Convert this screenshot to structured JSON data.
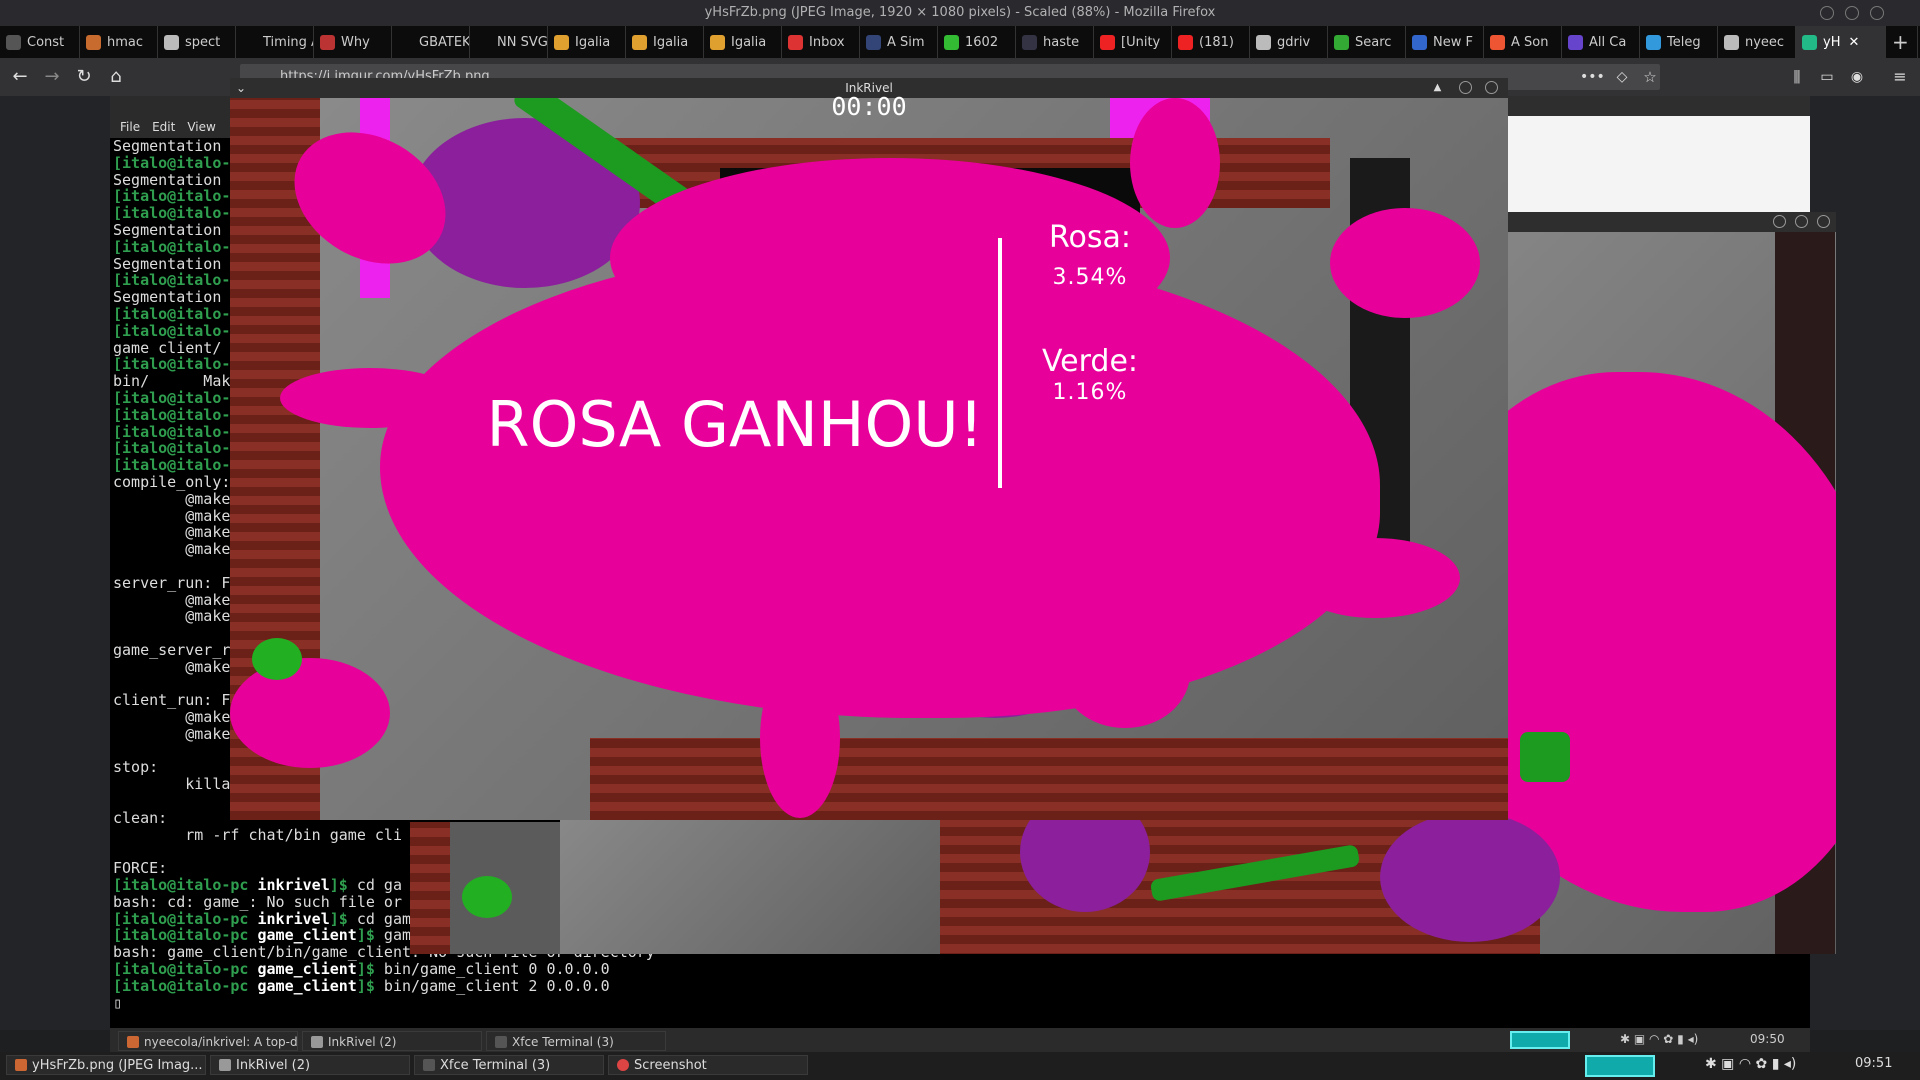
{
  "firefox": {
    "window_title": "yHsFrZb.png (JPEG Image, 1920 × 1080 pixels) - Scaled (88%) - Mozilla Firefox",
    "url": "https://i.imgur.com/yHsFrZb.png",
    "tabs": [
      {
        "label": "Const",
        "color": "#555"
      },
      {
        "label": "hmac",
        "color": "#c86b2f"
      },
      {
        "label": "spect",
        "color": "#bbb"
      },
      {
        "label": "Timing A",
        "color": "#0c0c0d"
      },
      {
        "label": "Why",
        "color": "#b33"
      },
      {
        "label": "GBATEK",
        "color": "#0c0c0d"
      },
      {
        "label": "NN SVG",
        "color": "#0c0c0d"
      },
      {
        "label": "Igalia",
        "color": "#e0a030"
      },
      {
        "label": "Igalia",
        "color": "#e0a030"
      },
      {
        "label": "Igalia",
        "color": "#e0a030"
      },
      {
        "label": "Inbox",
        "color": "#d33"
      },
      {
        "label": "A Sim",
        "color": "#347"
      },
      {
        "label": "1602",
        "color": "#3b3"
      },
      {
        "label": "haste",
        "color": "#334"
      },
      {
        "label": "[Unity",
        "color": "#e22"
      },
      {
        "label": "(181)",
        "color": "#e22"
      },
      {
        "label": "gdriv",
        "color": "#bbb"
      },
      {
        "label": "Searc",
        "color": "#3a3"
      },
      {
        "label": "New F",
        "color": "#36c"
      },
      {
        "label": "A Son",
        "color": "#e53"
      },
      {
        "label": "All Ca",
        "color": "#64c"
      },
      {
        "label": "Teleg",
        "color": "#39d"
      },
      {
        "label": "nyeec",
        "color": "#bbb"
      },
      {
        "label": "yH",
        "color": "#2b8"
      }
    ],
    "new_tab": "+",
    "close_tab": "✕"
  },
  "terminal": {
    "menu": [
      "File",
      "Edit",
      "View"
    ],
    "lines": [
      {
        "t": "Segmentation"
      },
      {
        "p": "[italo@italo-"
      },
      {
        "t": "Segmentation"
      },
      {
        "p": "[italo@italo-"
      },
      {
        "p": "[italo@italo-"
      },
      {
        "t": "Segmentation"
      },
      {
        "p": "[italo@italo-"
      },
      {
        "t": "Segmentation"
      },
      {
        "p": "[italo@italo-"
      },
      {
        "t": "Segmentation"
      },
      {
        "p": "[italo@italo-"
      },
      {
        "p": "[italo@italo-"
      },
      {
        "t": "game_client/"
      },
      {
        "p": "[italo@italo-"
      },
      {
        "t": "bin/      Mak"
      },
      {
        "p": "[italo@italo-"
      },
      {
        "p": "[italo@italo-"
      },
      {
        "p": "[italo@italo-"
      },
      {
        "p": "[italo@italo-"
      },
      {
        "p": "[italo@italo-"
      },
      {
        "t": "compile_only:"
      },
      {
        "t": "        @make"
      },
      {
        "t": "        @make"
      },
      {
        "t": "        @make"
      },
      {
        "t": "        @make"
      },
      {
        "t": ""
      },
      {
        "t": "server_run: F"
      },
      {
        "t": "        @make"
      },
      {
        "t": "        @make"
      },
      {
        "t": ""
      },
      {
        "t": "game_server_r"
      },
      {
        "t": "        @make"
      },
      {
        "t": ""
      },
      {
        "t": "client_run: F"
      },
      {
        "t": "        @make"
      },
      {
        "t": "        @make"
      },
      {
        "t": ""
      },
      {
        "t": "stop:"
      },
      {
        "t": "        killa"
      },
      {
        "t": ""
      },
      {
        "t": "clean:"
      },
      {
        "t": "        rm -rf chat/bin game_cli"
      },
      {
        "t": ""
      },
      {
        "t": "FORCE:"
      },
      {
        "p": "[italo@italo-pc ",
        "d": "inkrivel",
        "c": "]$ cd ga"
      },
      {
        "t": "bash: cd: game_: No such file or"
      },
      {
        "p": "[italo@italo-pc ",
        "d": "inkrivel",
        "c": "]$ cd game_client/"
      },
      {
        "p": "[italo@italo-pc ",
        "d": "game_client",
        "c": "]$ game_client/bin/game"
      },
      {
        "t": "bash: game_client/bin/game_client: No such file or directory"
      },
      {
        "p": "[italo@italo-pc ",
        "d": "game_client",
        "c": "]$ bin/game_client 0 0.0.0.0"
      },
      {
        "p": "[italo@italo-pc ",
        "d": "game_client",
        "c": "]$ bin/game_client 2 0.0.0.0"
      },
      {
        "t": "▯"
      }
    ]
  },
  "game": {
    "window_title": "InkRivel",
    "timer": "00:00",
    "winner": "ROSA GANHOU!",
    "team1_label": "Rosa:",
    "team1_value": "3.54%",
    "team2_label": "Verde:",
    "team2_value": "1.16%",
    "pink": "#e8009a",
    "purple": "#8b1f9c",
    "green": "#1d9a20"
  },
  "taskbar_inner": {
    "items": [
      "nyeecola/inkrivel: A top-d...",
      "InkRivel (2)",
      "Xfce Terminal (3)"
    ],
    "clock": "09:50"
  },
  "taskbar_outer": {
    "items": [
      "yHsFrZb.png (JPEG Imag...",
      "InkRivel (2)",
      "Xfce Terminal (3)",
      "Screenshot"
    ],
    "clock": "09:51"
  }
}
